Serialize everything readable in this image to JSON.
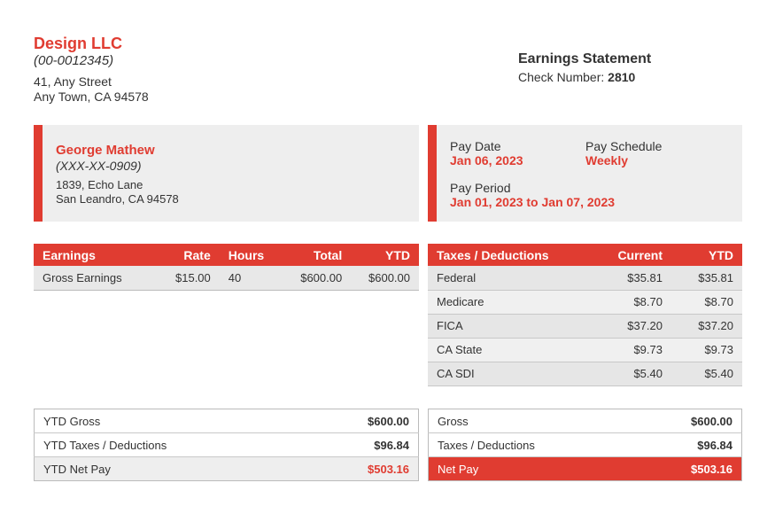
{
  "company": {
    "name": "Design LLC",
    "id": "(00-0012345)",
    "address_line1": "41, Any Street",
    "address_line2": "Any Town, CA 94578"
  },
  "statement": {
    "title": "Earnings Statement",
    "check_label": "Check Number: ",
    "check_number": "2810"
  },
  "employee": {
    "name": "George Mathew",
    "ssn": "(XXX-XX-0909)",
    "address_line1": "1839, Echo Lane",
    "address_line2": "San Leandro, CA 94578"
  },
  "pay_info": {
    "pay_date_label": "Pay Date",
    "pay_date": "Jan 06, 2023",
    "pay_schedule_label": "Pay Schedule",
    "pay_schedule": "Weekly",
    "pay_period_label": "Pay Period",
    "pay_period": "Jan 01, 2023 to Jan 07, 2023"
  },
  "earnings": {
    "headers": [
      "Earnings",
      "Rate",
      "Hours",
      "Total",
      "YTD"
    ],
    "rows": [
      [
        "Gross Earnings",
        "$15.00",
        "40",
        "$600.00",
        "$600.00"
      ]
    ]
  },
  "taxes": {
    "headers": [
      "Taxes / Deductions",
      "Current",
      "YTD"
    ],
    "rows": [
      [
        "Federal",
        "$35.81",
        "$35.81"
      ],
      [
        "Medicare",
        "$8.70",
        "$8.70"
      ],
      [
        "FICA",
        "$37.20",
        "$37.20"
      ],
      [
        "CA State",
        "$9.73",
        "$9.73"
      ],
      [
        "CA SDI",
        "$5.40",
        "$5.40"
      ]
    ]
  },
  "ytd_summary": [
    [
      "YTD Gross",
      "$600.00"
    ],
    [
      "YTD Taxes / Deductions",
      "$96.84"
    ],
    [
      "YTD Net Pay",
      "$503.16"
    ]
  ],
  "current_summary": [
    [
      "Gross",
      "$600.00"
    ],
    [
      "Taxes / Deductions",
      "$96.84"
    ],
    [
      "Net Pay",
      "$503.16"
    ]
  ],
  "colors": {
    "accent": "#e03c31",
    "panel": "#eeeeee"
  }
}
